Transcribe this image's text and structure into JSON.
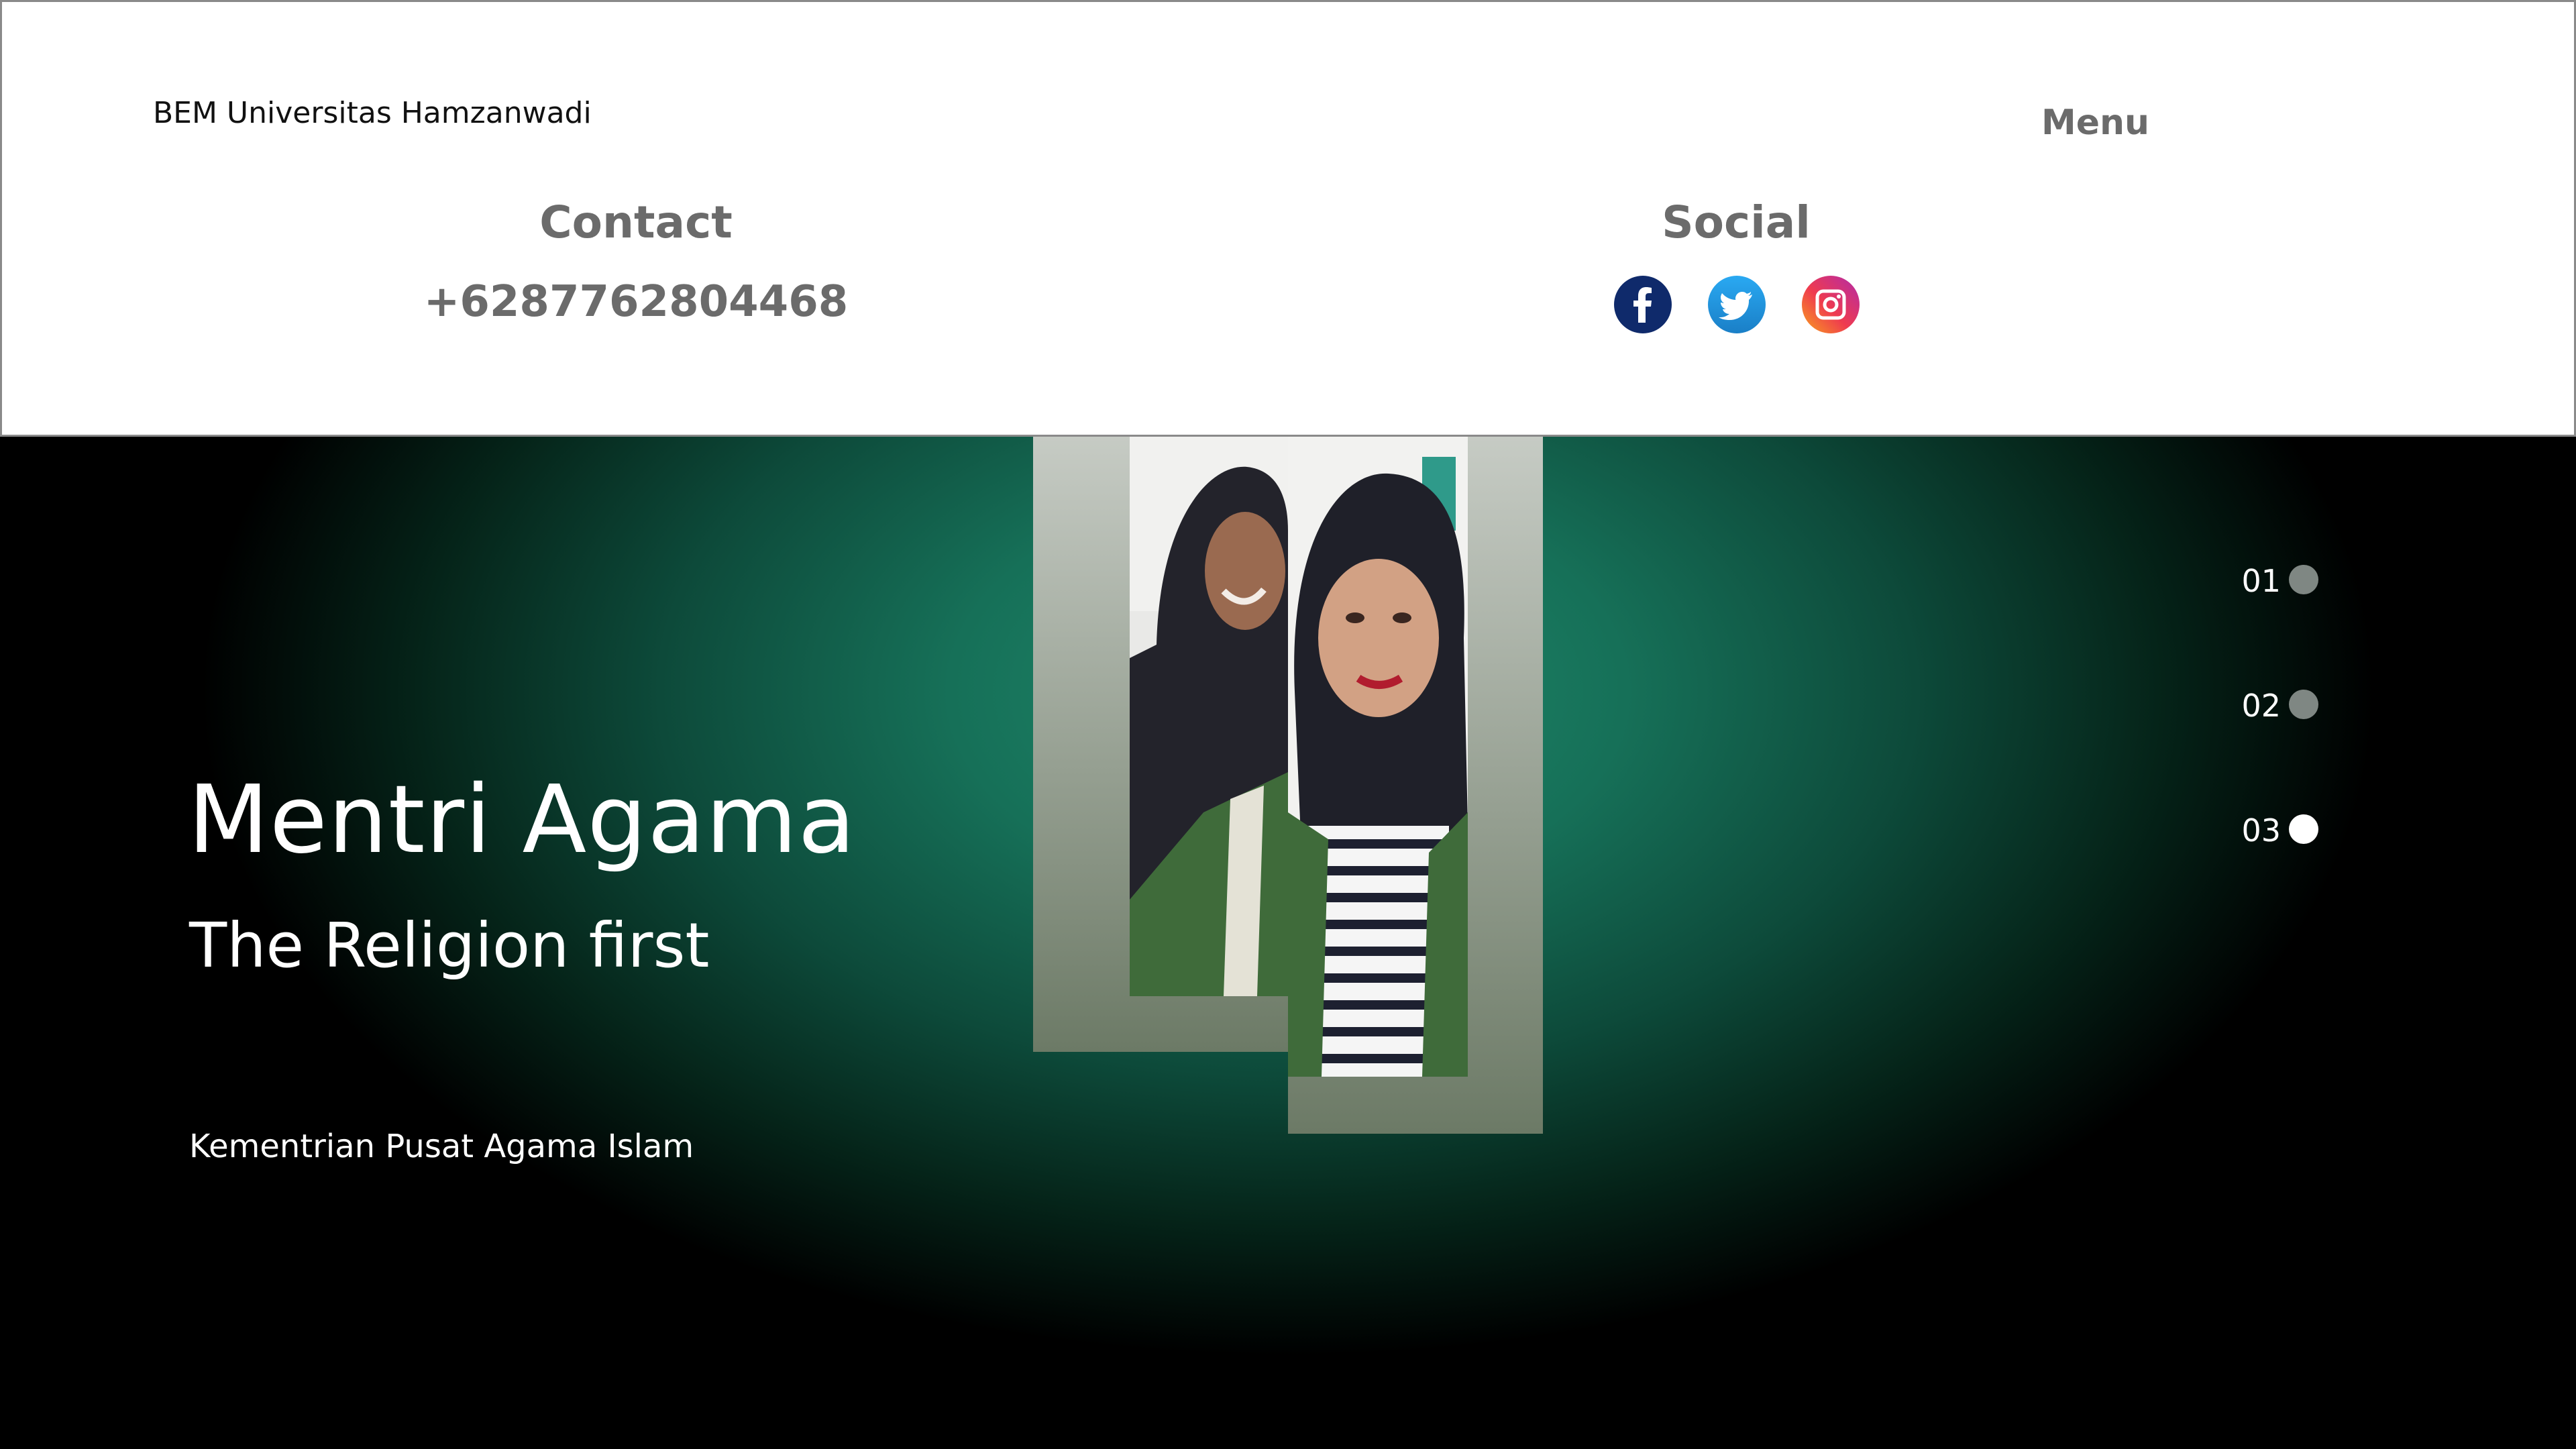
{
  "header": {
    "brand": "BEM Universitas Hamzanwadi",
    "menu_label": "Menu",
    "contact": {
      "title": "Contact",
      "phone": "+6287762804468"
    },
    "social": {
      "title": "Social",
      "icons": [
        "facebook-icon",
        "twitter-icon",
        "instagram-icon"
      ]
    }
  },
  "hero": {
    "title": "Mentri Agama",
    "subtitle": "The Religion first",
    "caption": "Kementrian Pusat Agama Islam",
    "indicators": [
      {
        "label": "01",
        "active": false
      },
      {
        "label": "02",
        "active": false
      },
      {
        "label": "03",
        "active": true
      }
    ]
  },
  "colors": {
    "header_bg": "#ffffff",
    "header_text": "#6b6b6b",
    "hero_green": "#1f8a6c",
    "hero_dark": "#000000",
    "indicator_inactive": "#7f8783",
    "indicator_active": "#ffffff",
    "facebook": "#0f2a6b",
    "twitter": "#1d9bf0"
  }
}
